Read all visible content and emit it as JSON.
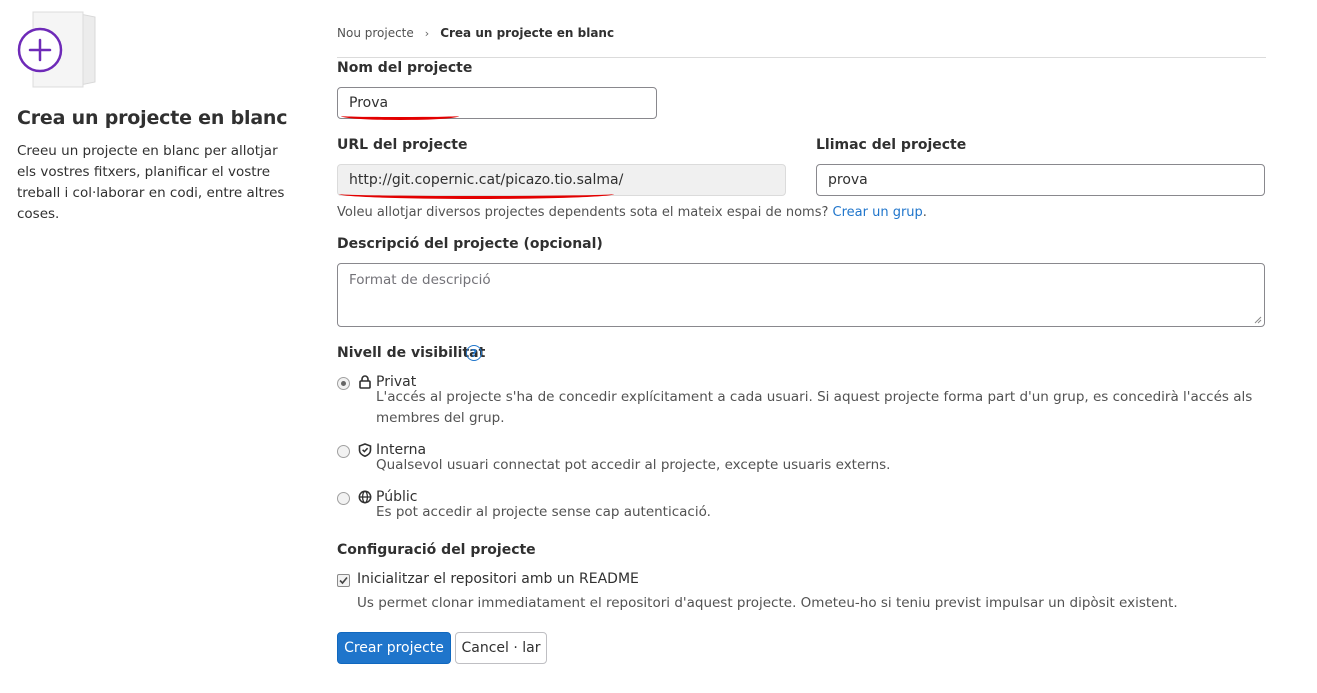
{
  "left": {
    "title": "Crea un projecte en blanc",
    "description": "Creeu un projecte en blanc per allotjar els vostres fitxers, planificar el vostre treball i col·laborar en codi, entre altres coses.",
    "accent_color": "#6e2ab8"
  },
  "breadcrumb": {
    "items": [
      "Nou projecte",
      "Crea un projecte en blanc"
    ]
  },
  "form": {
    "name_label": "Nom del projecte",
    "name_value": "Prova",
    "url_label": "URL del projecte",
    "url_value": "http://git.copernic.cat/picazo.tio.salma/",
    "slug_label": "Llimac del projecte",
    "slug_value": "prova",
    "namespace_help": "Voleu allotjar diversos projectes dependents sota el mateix espai de noms?",
    "namespace_link": "Crear un grup",
    "namespace_help_end": ".",
    "description_label": "Descripció del projecte (opcional)",
    "description_placeholder": "Format de descripció",
    "visibility_label": "Nivell de visibilitat",
    "visibility_help_icon": "question-circle-icon",
    "visibility_options": [
      {
        "title": "Privat",
        "icon": "lock-icon",
        "description": "L'accés al projecte s'ha de concedir explícitament a cada usuari. Si aquest projecte forma part d'un grup, es concedirà l'accés als membres del grup.",
        "selected": true
      },
      {
        "title": "Interna",
        "icon": "shield-icon",
        "description": "Qualsevol usuari connectat pot accedir al projecte, excepte usuaris externs.",
        "selected": false
      },
      {
        "title": "Públic",
        "icon": "globe-icon",
        "description": "Es pot accedir al projecte sense cap autenticació.",
        "selected": false
      }
    ],
    "config_label": "Configuració del projecte",
    "readme_label": "Inicialitzar el repositori amb un README",
    "readme_checked": true,
    "readme_help": "Us permet clonar immediatament el repositori d'aquest projecte. Ometeu-ho si teniu previst impulsar un dipòsit existent.",
    "submit_label": "Crear projecte",
    "cancel_label": "Cancel · lar"
  },
  "colors": {
    "primary": "#1f75cb",
    "annotation_red": "#e30000"
  }
}
